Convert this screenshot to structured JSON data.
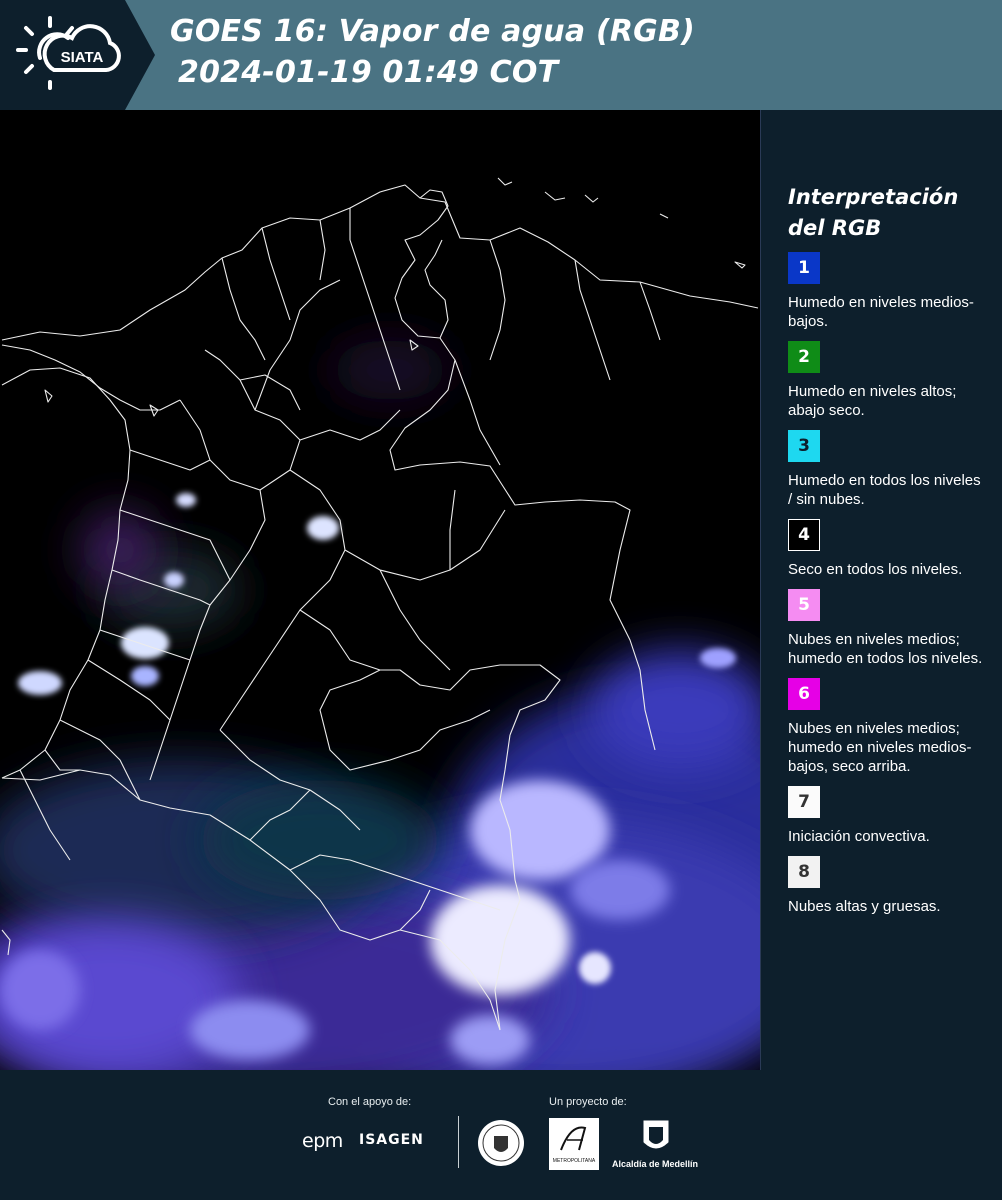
{
  "header": {
    "logo_text": "SIATA",
    "title_line1": "GOES 16: Vapor de agua (RGB)",
    "title_line2": "2024-01-19 01:49 COT"
  },
  "legend": {
    "title_line1": "Interpretación",
    "title_line2": "del RGB",
    "items": [
      {
        "number": "1",
        "color": "#0a37c8",
        "text_color": "#ffffff",
        "text": "Humedo en niveles medios-bajos."
      },
      {
        "number": "2",
        "color": "#0f8c17",
        "text_color": "#ffffff",
        "text": "Humedo en niveles altos; abajo seco."
      },
      {
        "number": "3",
        "color": "#1ed8f0",
        "text_color": "#0d1f2c",
        "text": "Humedo en todos los niveles / sin nubes."
      },
      {
        "number": "4",
        "color": "#000000",
        "text_color": "#ffffff",
        "text": "Seco en todos los niveles."
      },
      {
        "number": "5",
        "color": "#f58cf2",
        "text_color": "#ffffff",
        "text": "Nubes en niveles medios; humedo en todos los niveles."
      },
      {
        "number": "6",
        "color": "#e600e6",
        "text_color": "#ffffff",
        "text": "Nubes en niveles medios; humedo en niveles medios-bajos, seco arriba."
      },
      {
        "number": "7",
        "color": "#fbfbfb",
        "text_color": "#333333",
        "text": "Iniciación convectiva."
      },
      {
        "number": "8",
        "color": "#f2f2f2",
        "text_color": "#333333",
        "text": "Nubes altas y gruesas."
      }
    ]
  },
  "footer": {
    "support_label": "Con el apoyo de:",
    "project_label": "Un proyecto de:",
    "epm_logo": "epm",
    "isagen_logo": "ISAGEN",
    "area_logo_text": "METROPOLITANA",
    "medellin_logo_text": "Alcaldía de Medellín"
  }
}
